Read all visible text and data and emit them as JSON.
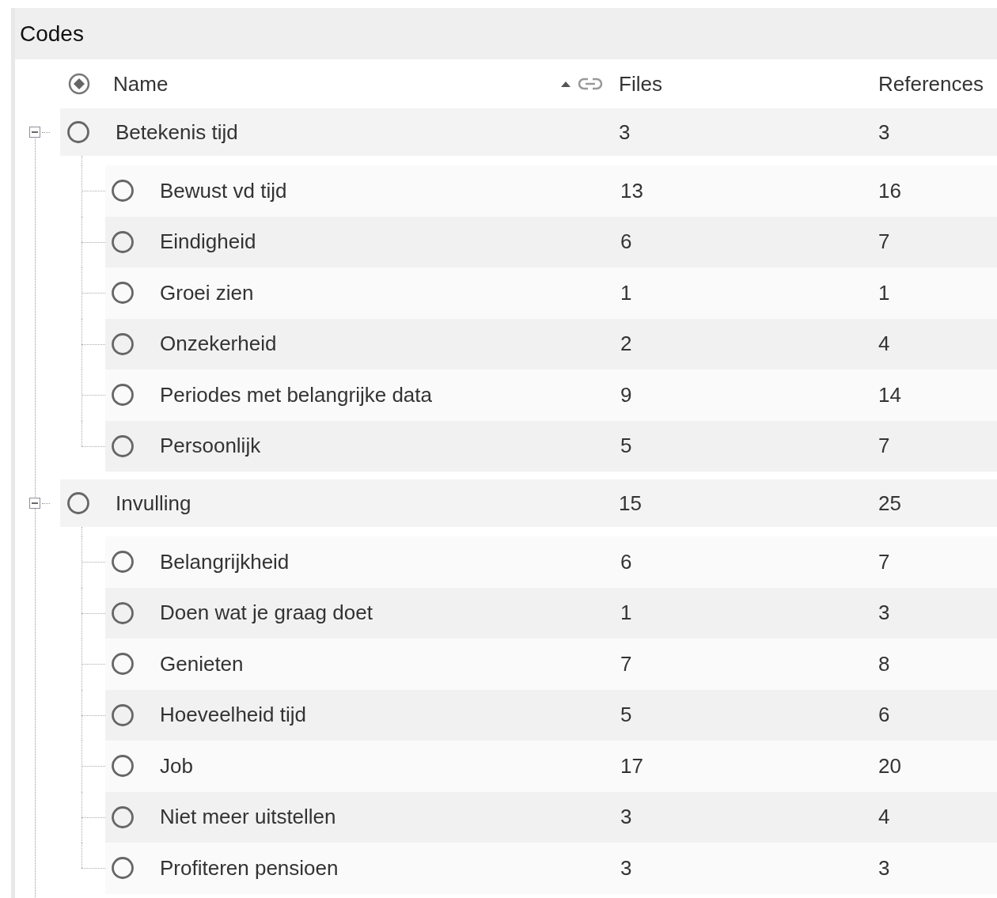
{
  "panel": {
    "title": "Codes"
  },
  "columns": [
    {
      "label": "Name",
      "sorted": true
    },
    {
      "label": "Files"
    },
    {
      "label": "References"
    }
  ],
  "codes": [
    {
      "name": "Betekenis tijd",
      "files": "3",
      "references": "3",
      "expanded": true,
      "children": [
        {
          "name": "Bewust vd tijd",
          "files": "13",
          "references": "16"
        },
        {
          "name": "Eindigheid",
          "files": "6",
          "references": "7"
        },
        {
          "name": "Groei zien",
          "files": "1",
          "references": "1"
        },
        {
          "name": "Onzekerheid",
          "files": "2",
          "references": "4"
        },
        {
          "name": "Periodes met belangrijke data",
          "files": "9",
          "references": "14"
        },
        {
          "name": "Persoonlijk",
          "files": "5",
          "references": "7"
        }
      ]
    },
    {
      "name": "Invulling",
      "files": "15",
      "references": "25",
      "expanded": true,
      "children": [
        {
          "name": "Belangrijkheid",
          "files": "6",
          "references": "7"
        },
        {
          "name": "Doen wat je graag doet",
          "files": "1",
          "references": "3"
        },
        {
          "name": "Genieten",
          "files": "7",
          "references": "8"
        },
        {
          "name": "Hoeveelheid tijd",
          "files": "5",
          "references": "6"
        },
        {
          "name": "Job",
          "files": "17",
          "references": "20"
        },
        {
          "name": "Niet meer uitstellen",
          "files": "3",
          "references": "4"
        },
        {
          "name": "Profiteren pensioen",
          "files": "3",
          "references": "3"
        }
      ]
    }
  ]
}
